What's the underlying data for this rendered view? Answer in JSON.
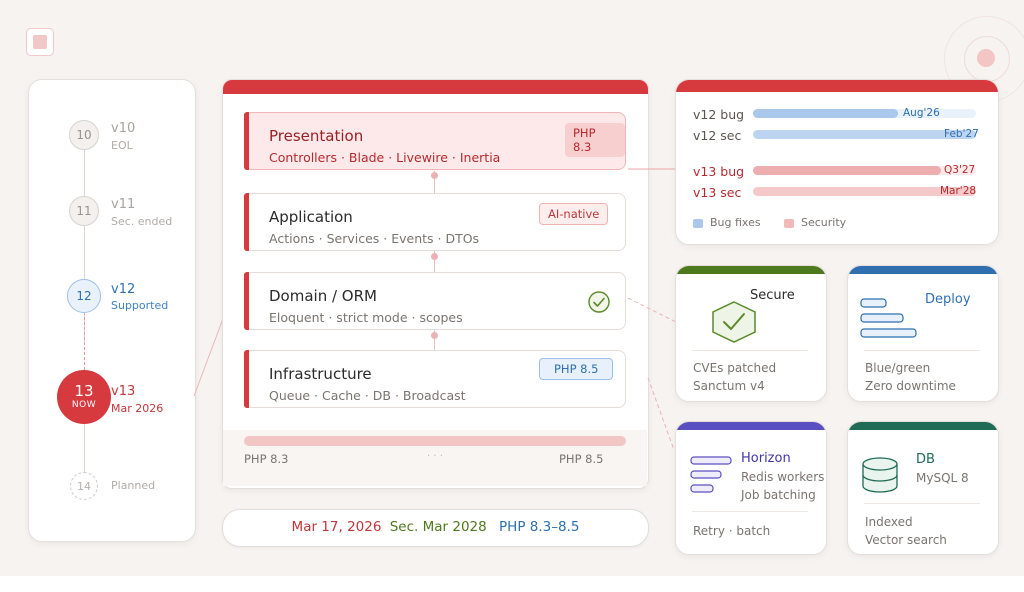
{
  "timeline": [
    {
      "num": "10",
      "version": "v10",
      "status": "EOL"
    },
    {
      "num": "11",
      "version": "v11",
      "status": "Sec. ended"
    },
    {
      "num": "12",
      "version": "v12",
      "status": "Supported"
    },
    {
      "num": "13",
      "now": "NOW",
      "version": "v13",
      "status": "Mar 2026"
    },
    {
      "num": "14",
      "status": "Planned"
    }
  ],
  "layers": [
    {
      "title": "Presentation",
      "items": "Controllers · Blade · Livewire · Inertia",
      "badge": "PHP 8.3"
    },
    {
      "title": "Application",
      "items": "Actions · Services · Events · DTOs",
      "badge": "AI-native"
    },
    {
      "title": "Domain / ORM",
      "items": "Eloquent · strict mode · scopes",
      "badge_icon": "check-circle-icon"
    },
    {
      "title": "Infrastructure",
      "items": "Queue · Cache · DB · Broadcast",
      "badge": "PHP 8.5"
    }
  ],
  "php_range": {
    "start": "PHP 8.3",
    "dots": "· · ·",
    "end": "PHP 8.5"
  },
  "footer": {
    "date": "Mar 17, 2026",
    "security": "Sec. Mar 2028",
    "php": "PHP 8.3–8.5"
  },
  "support_chart": {
    "rows": [
      {
        "label": "v12 bug",
        "end": "Aug'26",
        "fill": 0.67,
        "type": "bug"
      },
      {
        "label": "v12 sec",
        "end": "Feb'27",
        "fill": 1.0,
        "type": "bug"
      },
      {
        "label": "v13 bug",
        "end": "Q3'27",
        "fill": 0.84,
        "type": "sec"
      },
      {
        "label": "v13 sec",
        "end": "Mar'28",
        "fill": 1.0,
        "type": "sec"
      }
    ],
    "legend": [
      {
        "label": "Bug fixes",
        "color": "#a9c8ec"
      },
      {
        "label": "Security",
        "color": "#f1b9bb"
      }
    ]
  },
  "cards": {
    "secure": {
      "title": "Secure",
      "line1": "CVEs patched",
      "line2": "Sanctum v4",
      "icon": "shield-check-icon"
    },
    "deploy": {
      "title": "Deploy",
      "line1": "Blue/green",
      "line2": "Zero downtime",
      "icon": "bars-icon"
    },
    "horizon": {
      "title": "Horizon",
      "sub1": "Redis workers",
      "sub2": "Job batching",
      "footer": "Retry · batch",
      "icon": "queue-icon"
    },
    "db": {
      "title": "DB",
      "sub1": "MySQL 8",
      "line1": "Indexed",
      "line2": "Vector search",
      "icon": "database-icon"
    }
  },
  "colors": {
    "red": "#d63a3e",
    "blue": "#2f6fb0",
    "green": "#4d7a1f",
    "purple": "#5a4fc0",
    "teal": "#1f6b55"
  }
}
